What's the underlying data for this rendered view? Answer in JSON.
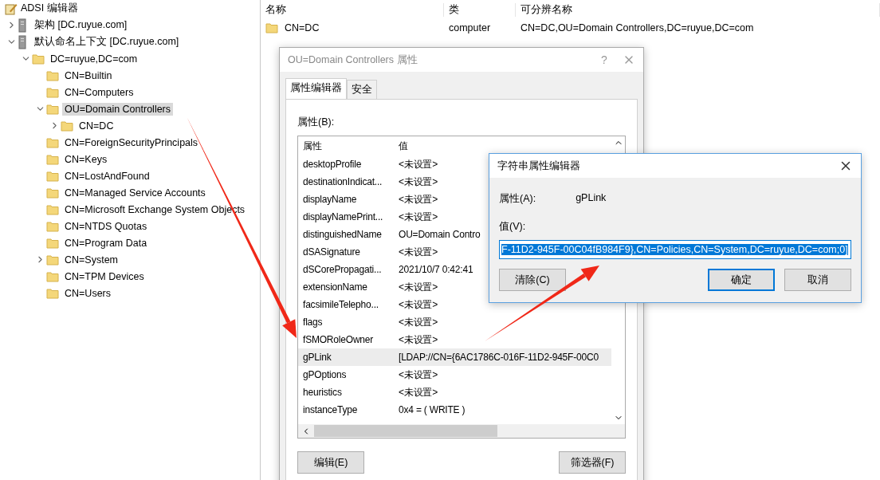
{
  "app": {
    "title": "ADSI 编辑器"
  },
  "tree": [
    {
      "kind": "server",
      "label": "架构 [DC.ruyue.com]",
      "expanded": false,
      "selected": false
    },
    {
      "kind": "server",
      "label": "默认命名上下文 [DC.ruyue.com]",
      "expanded": true,
      "selected": false,
      "children": [
        {
          "kind": "folder",
          "label": "DC=ruyue,DC=com",
          "expanded": true,
          "selected": false,
          "children": [
            {
              "kind": "folder",
              "label": "CN=Builtin",
              "selected": false
            },
            {
              "kind": "folder",
              "label": "CN=Computers",
              "selected": false
            },
            {
              "kind": "folder",
              "label": "OU=Domain Controllers",
              "expanded": true,
              "selected": true,
              "children": [
                {
                  "kind": "folder",
                  "label": "CN=DC",
                  "expanded": false,
                  "selected": false
                }
              ]
            },
            {
              "kind": "folder",
              "label": "CN=ForeignSecurityPrincipals",
              "selected": false
            },
            {
              "kind": "folder",
              "label": "CN=Keys",
              "selected": false
            },
            {
              "kind": "folder",
              "label": "CN=LostAndFound",
              "selected": false
            },
            {
              "kind": "folder",
              "label": "CN=Managed Service Accounts",
              "selected": false
            },
            {
              "kind": "folder",
              "label": "CN=Microsoft Exchange System Objects",
              "selected": false
            },
            {
              "kind": "folder",
              "label": "CN=NTDS Quotas",
              "selected": false
            },
            {
              "kind": "folder",
              "label": "CN=Program Data",
              "selected": false
            },
            {
              "kind": "folder",
              "label": "CN=System",
              "expanded": false,
              "selected": false
            },
            {
              "kind": "folder",
              "label": "CN=TPM Devices",
              "selected": false
            },
            {
              "kind": "folder",
              "label": "CN=Users",
              "selected": false
            }
          ]
        }
      ]
    }
  ],
  "list": {
    "columns": [
      "名称",
      "类",
      "可分辨名称"
    ],
    "rows": [
      {
        "name": "CN=DC",
        "class": "computer",
        "dn": "CN=DC,OU=Domain Controllers,DC=ruyue,DC=com"
      }
    ]
  },
  "props_dialog": {
    "title": "OU=Domain Controllers 属性",
    "help": "?",
    "tabs": [
      {
        "label": "属性编辑器",
        "selected": true
      },
      {
        "label": "安全",
        "selected": false
      }
    ],
    "attr_label": "属性(B):",
    "columns": [
      "属性",
      "值"
    ],
    "rows": [
      {
        "name": "desktopProfile",
        "value": "<未设置>",
        "selected": false
      },
      {
        "name": "destinationIndicat...",
        "value": "<未设置>",
        "selected": false
      },
      {
        "name": "displayName",
        "value": "<未设置>",
        "selected": false
      },
      {
        "name": "displayNamePrint...",
        "value": "<未设置>",
        "selected": false
      },
      {
        "name": "distinguishedName",
        "value": "OU=Domain Contro",
        "selected": false
      },
      {
        "name": "dSASignature",
        "value": "<未设置>",
        "selected": false
      },
      {
        "name": "dSCorePropagati...",
        "value": "2021/10/7 0:42:41",
        "selected": false
      },
      {
        "name": "extensionName",
        "value": "<未设置>",
        "selected": false
      },
      {
        "name": "facsimileTelepho...",
        "value": "<未设置>",
        "selected": false
      },
      {
        "name": "flags",
        "value": "<未设置>",
        "selected": false
      },
      {
        "name": "fSMORoleOwner",
        "value": "<未设置>",
        "selected": false
      },
      {
        "name": "gPLink",
        "value": "[LDAP://CN={6AC1786C-016F-11D2-945F-00C0",
        "selected": true
      },
      {
        "name": "gPOptions",
        "value": "<未设置>",
        "selected": false
      },
      {
        "name": "heuristics",
        "value": "<未设置>",
        "selected": false
      },
      {
        "name": "instanceType",
        "value": "0x4 = ( WRITE )",
        "selected": false
      }
    ],
    "buttons": [
      "编辑(E)",
      "筛选器(F)"
    ]
  },
  "string_editor": {
    "title": "字符串属性编辑器",
    "attr_label": "属性(A):",
    "attr_value": "gPLink",
    "value_label": "值(V):",
    "value": "F-11D2-945F-00C04fB984F9},CN=Policies,CN=System,DC=ruyue,DC=com;0]",
    "value_selected": true,
    "buttons": [
      {
        "label": "清除(C)",
        "default": false
      },
      {
        "label": "确定",
        "default": true
      },
      {
        "label": "取消",
        "default": false
      }
    ]
  }
}
